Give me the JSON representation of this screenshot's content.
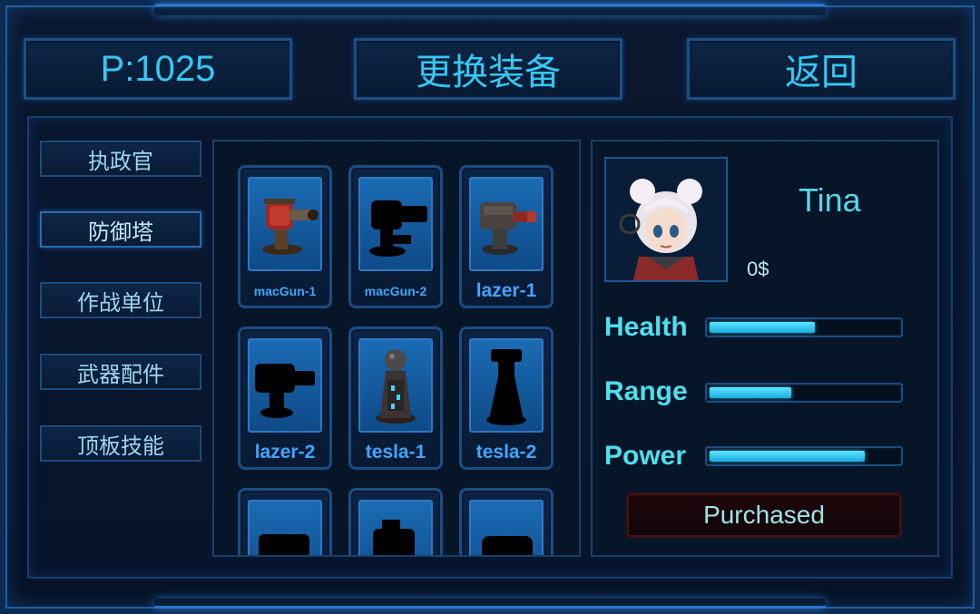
{
  "header": {
    "points": "P:1025",
    "title": "更换装备",
    "back": "返回"
  },
  "categories": [
    {
      "label": "执政官"
    },
    {
      "label": "防御塔"
    },
    {
      "label": "作战单位"
    },
    {
      "label": "武器配件"
    },
    {
      "label": "顶板技能"
    }
  ],
  "items": [
    {
      "label": "macGun-1",
      "unlocked": true
    },
    {
      "label": "macGun-2",
      "unlocked": false
    },
    {
      "label": "lazer-1",
      "unlocked": true
    },
    {
      "label": "lazer-2",
      "unlocked": false
    },
    {
      "label": "tesla-1",
      "unlocked": true
    },
    {
      "label": "tesla-2",
      "unlocked": false
    }
  ],
  "hero": {
    "name": "Tina",
    "price": "0$",
    "stats": [
      {
        "label": "Health",
        "value": 0.57
      },
      {
        "label": "Range",
        "value": 0.44
      },
      {
        "label": "Power",
        "value": 0.84
      }
    ],
    "status_button": "Purchased"
  },
  "colors": {
    "accent_cyan": "#35c8f4",
    "stat_label": "#4de0ee",
    "item_label": "#3fa6ff",
    "frame_blue": "#1f5fa3",
    "purchased_bg": "#1d070b"
  }
}
